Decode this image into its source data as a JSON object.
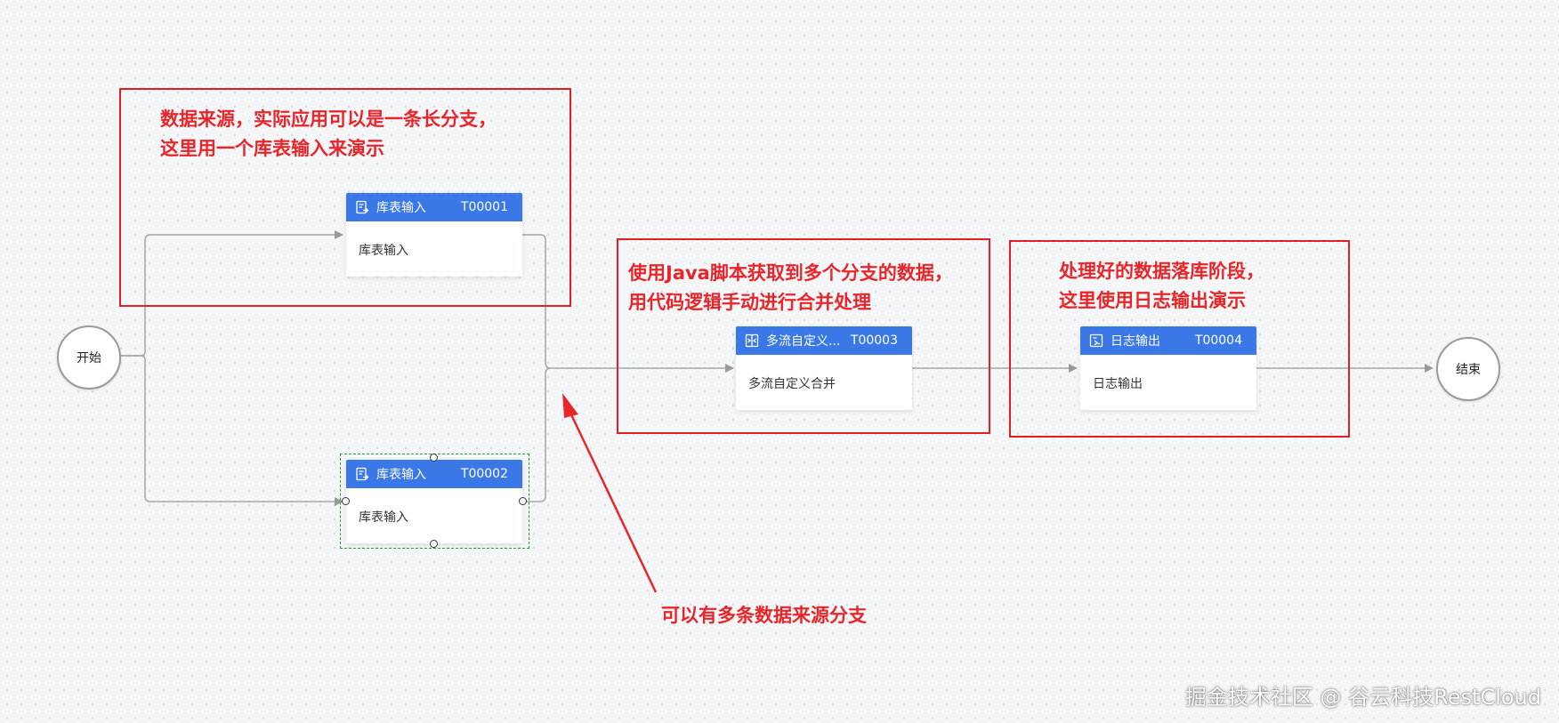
{
  "nodes": {
    "start": {
      "label": "开始"
    },
    "end": {
      "label": "结束"
    },
    "t1": {
      "name": "库表输入",
      "id": "T00001",
      "body": "库表输入",
      "icon": "table-input-icon"
    },
    "t2": {
      "name": "库表输入",
      "id": "T00002",
      "body": "库表输入",
      "icon": "table-input-icon"
    },
    "t3": {
      "name": "多流自定义...",
      "id": "T00003",
      "body": "多流自定义合并",
      "icon": "multi-stream-icon"
    },
    "t4": {
      "name": "日志输出",
      "id": "T00004",
      "body": "日志输出",
      "icon": "log-output-icon"
    }
  },
  "annotations": {
    "source": {
      "line1": "数据来源，实际应用可以是一条长分支，",
      "line2": "这里用一个库表输入来演示"
    },
    "merge": {
      "line1": "使用Java脚本获取到多个分支的数据，",
      "line2": "用代码逻辑手动进行合并处理"
    },
    "sink": {
      "line1": "处理好的数据落库阶段，",
      "line2": "这里使用日志输出演示"
    },
    "branches": {
      "text": "可以有多条数据来源分支"
    }
  },
  "watermark": "掘金技术社区 @ 谷云科技RestCloud",
  "colors": {
    "node_header": "#3a78e8",
    "annotation": "#e8262a",
    "edge": "#a0a0a0",
    "selection": "#22a32a"
  }
}
